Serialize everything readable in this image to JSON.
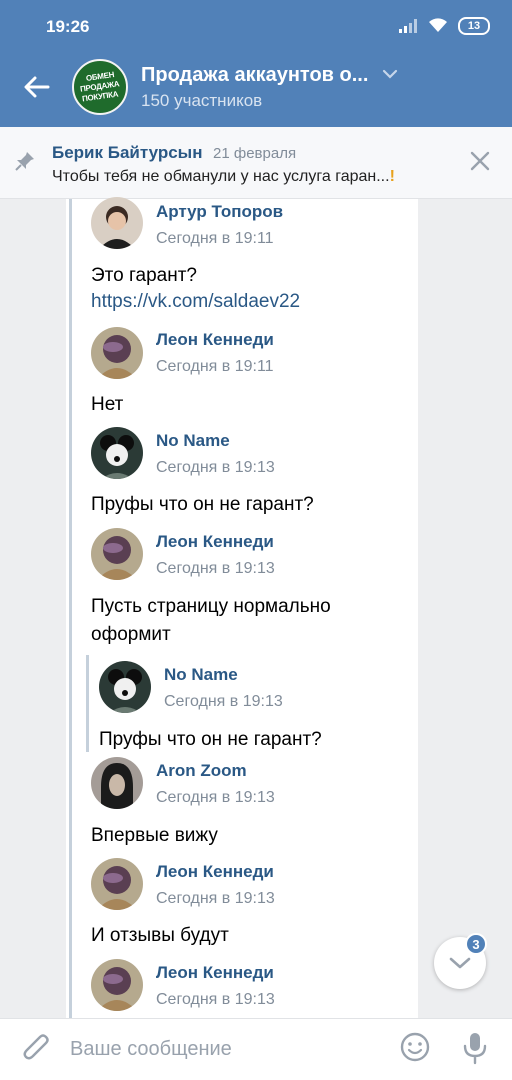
{
  "status": {
    "time": "19:26",
    "battery": "13"
  },
  "header": {
    "title": "Продажа аккаунтов о...",
    "subtitle": "150 участников",
    "avatar_lines": [
      "ОБМЕН",
      "ПРОДАЖА",
      "ПОКУПКА"
    ]
  },
  "pinned": {
    "author": "Берик Байтурсын",
    "date": "21 февраля",
    "text": "Чтобы тебя не обманули у нас услуга гаран...",
    "emoji": "!"
  },
  "messages": [
    {
      "author": "Артур Топоров",
      "time": "Сегодня в 19:11",
      "text": "Это гарант?",
      "link": "https://vk.com/saldaev22"
    },
    {
      "author": "Леон Кеннеди",
      "time": "Сегодня в 19:11",
      "text": "Нет"
    },
    {
      "author": "No Name",
      "time": "Сегодня в 19:13",
      "text": "Пруфы что он не гарант?"
    },
    {
      "author": "Леон Кеннеди",
      "time": "Сегодня в 19:13",
      "text": "Пусть страницу нормально оформит",
      "quote": {
        "author": "No Name",
        "time": "Сегодня в 19:13",
        "text": "Пруфы что он не гарант?"
      }
    },
    {
      "author": "Aron Zoom",
      "time": "Сегодня в 19:13",
      "text": "Впервые вижу"
    },
    {
      "author": "Леон Кеннеди",
      "time": "Сегодня в 19:13",
      "text": "И отзывы будут"
    },
    {
      "author": "Леон Кеннеди",
      "time": "Сегодня в 19:13"
    }
  ],
  "scroll": {
    "badge": "3"
  },
  "composer": {
    "placeholder": "Ваше сообщение"
  },
  "colors": {
    "accent": "#5181b8",
    "link": "#2a5885",
    "muted": "#818c99"
  }
}
